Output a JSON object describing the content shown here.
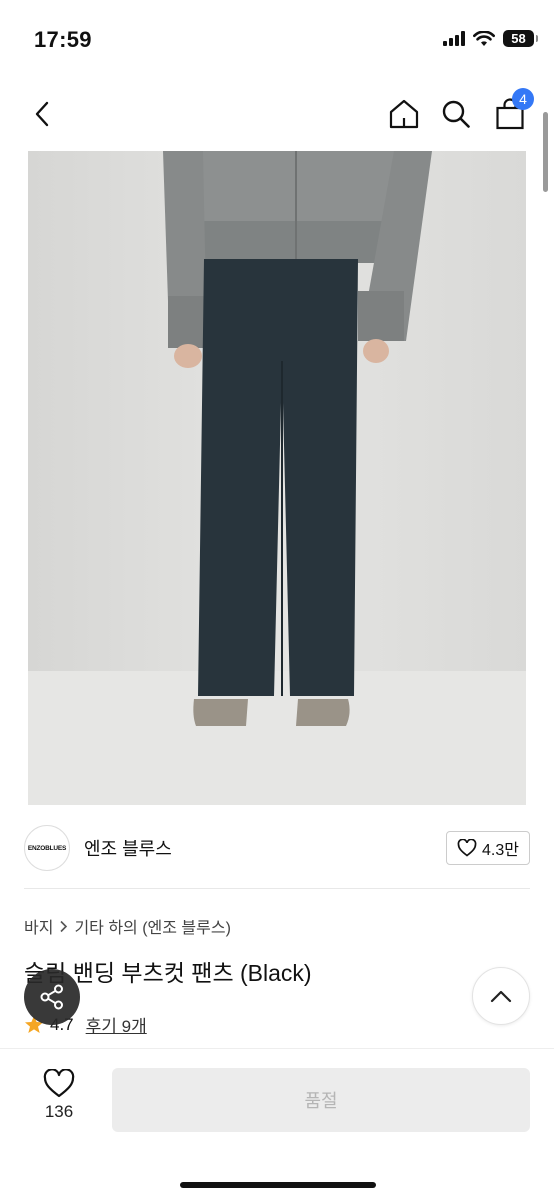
{
  "status_bar": {
    "time": "17:59",
    "battery": "58"
  },
  "nav": {
    "cart_count": "4"
  },
  "shop": {
    "logo_text": "ENZOBLUES",
    "name": "엔조 블루스",
    "like_count": "4.3만"
  },
  "breadcrumb": {
    "category": "바지",
    "sub_category": "기타 하의 (엔조 블루스)"
  },
  "product": {
    "title": "슬림 밴딩 부츠컷 팬츠 (Black)",
    "rating": "4.7",
    "reviews": "후기 9개"
  },
  "bottom_bar": {
    "wish_count": "136",
    "soldout_label": "품절"
  },
  "colors": {
    "accent": "#3478f6",
    "star": "#f5a623",
    "soldout_bg": "#ececec"
  }
}
